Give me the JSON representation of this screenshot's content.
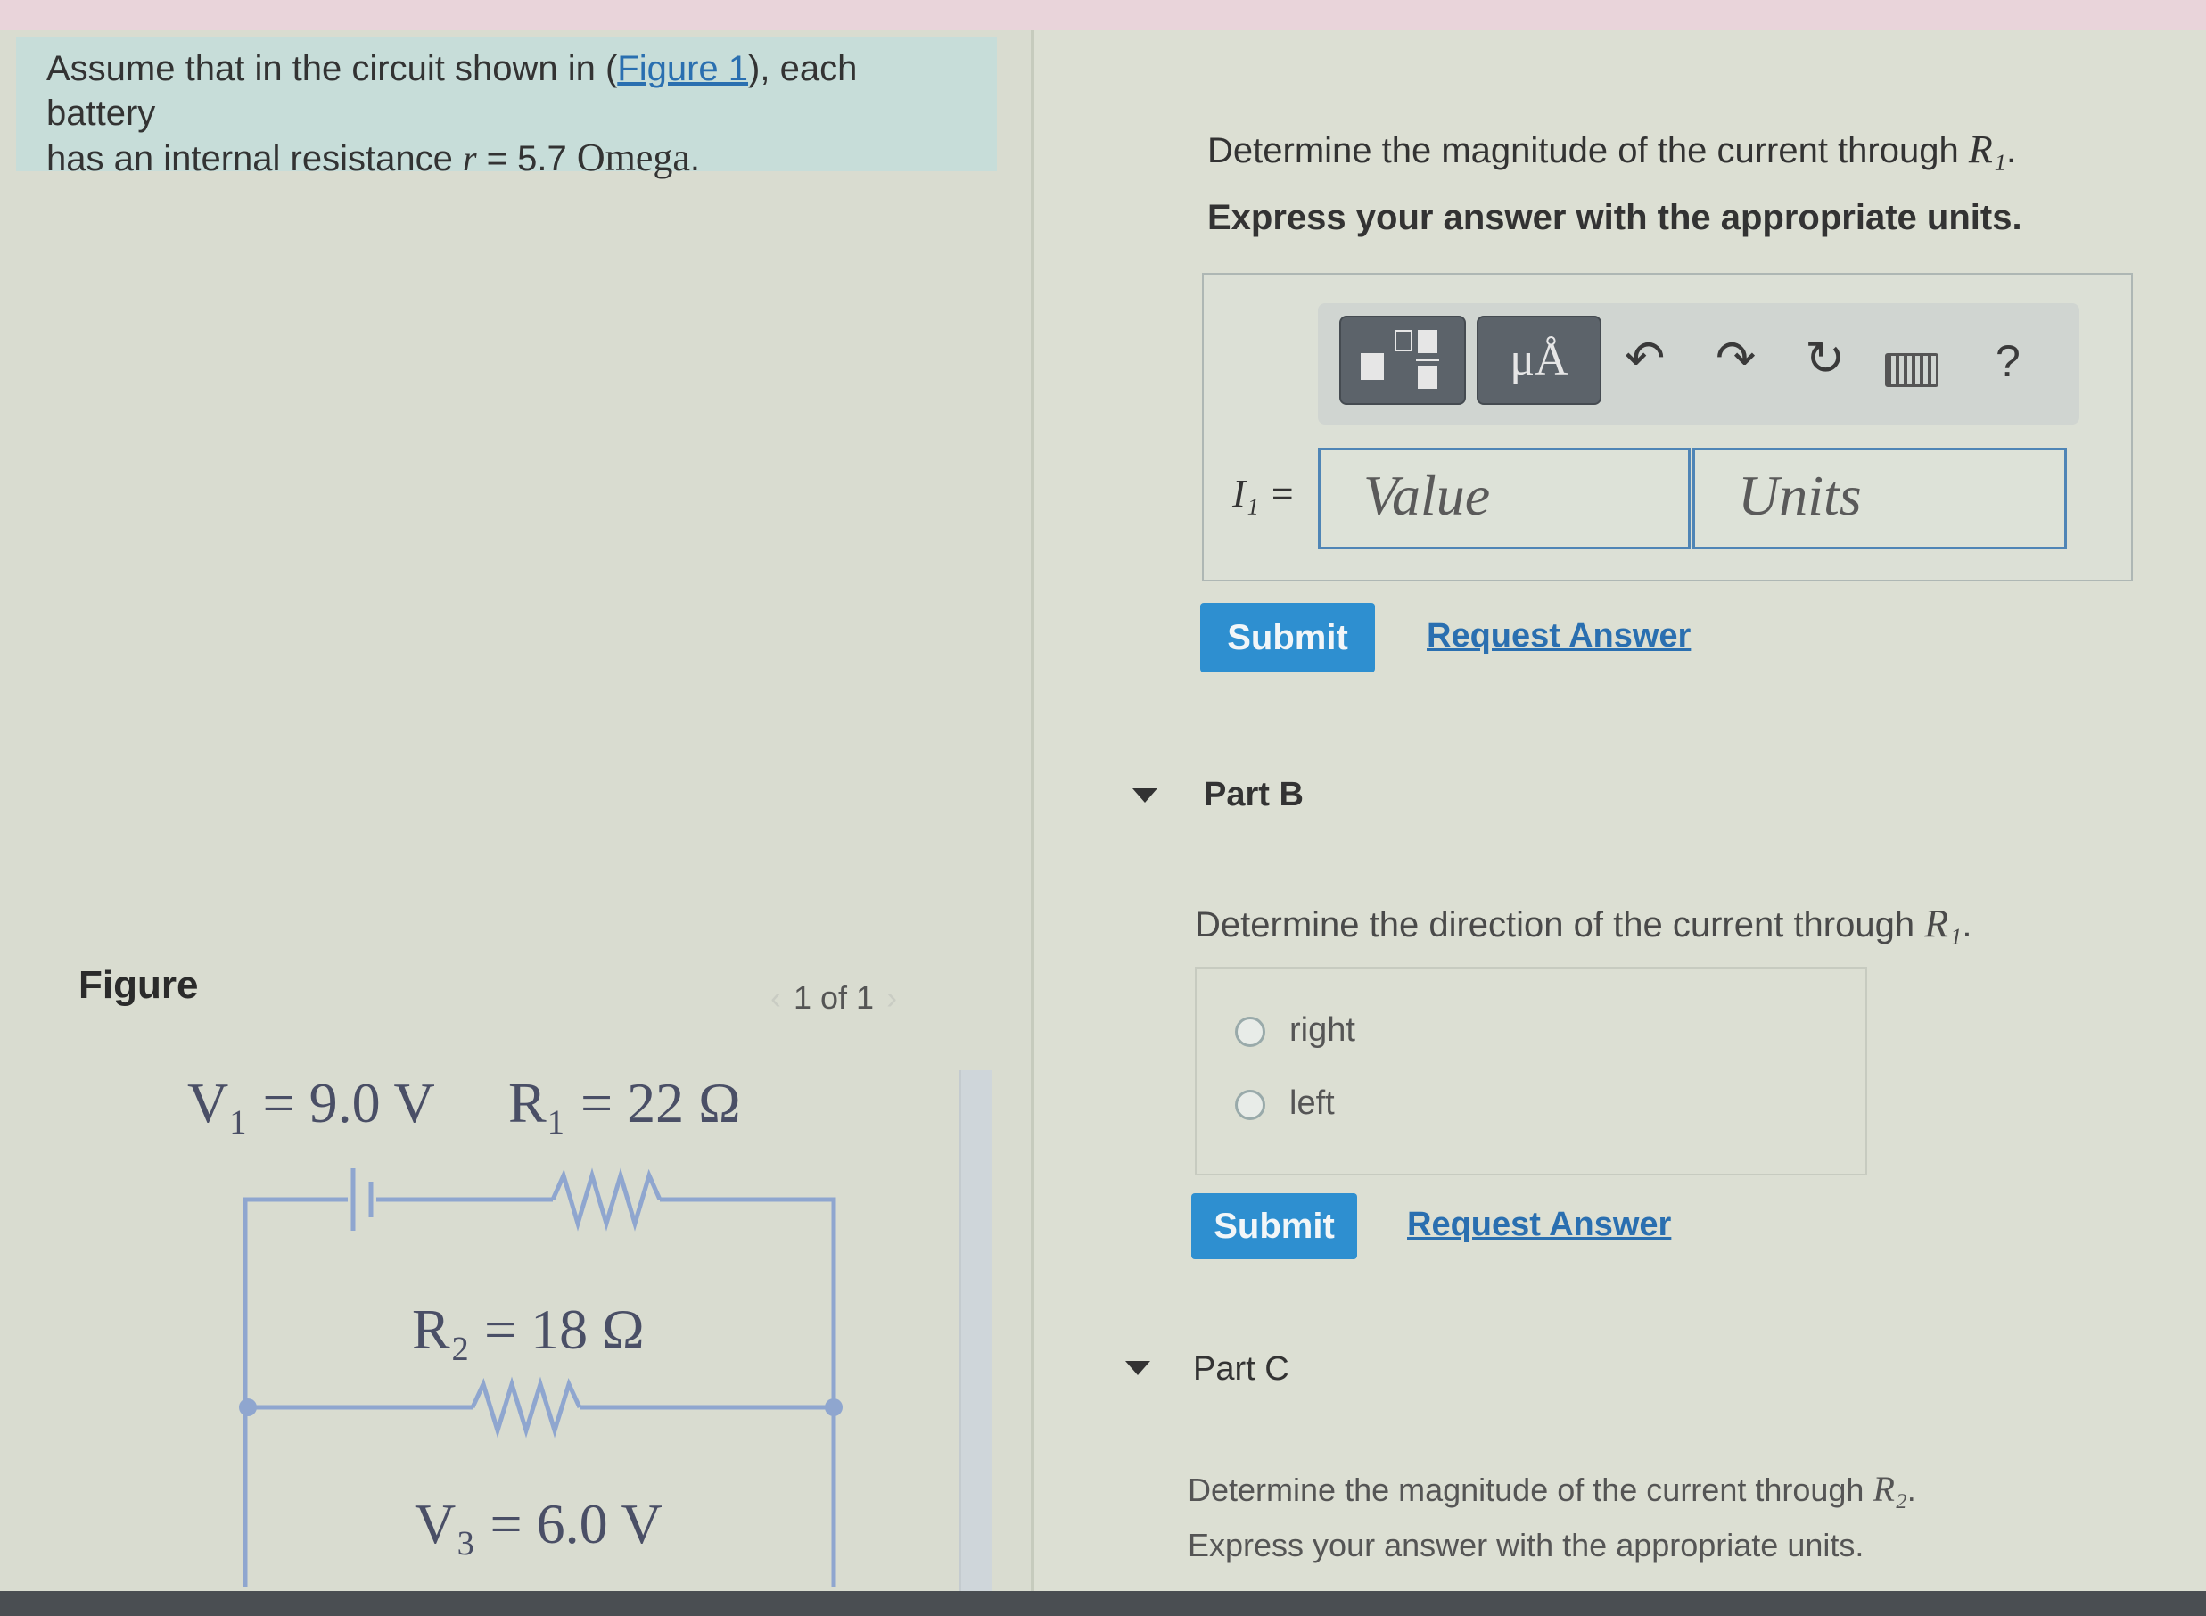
{
  "problem": {
    "intro_part1": "Assume that in the circuit shown in (",
    "figure_link": "Figure 1",
    "intro_part2": "), each battery",
    "intro_line2_a": "has an internal resistance ",
    "r_symbol": "r",
    "r_value": " = 5.7 ",
    "omega_word": "Omega",
    "period": "."
  },
  "figure": {
    "label": "Figure",
    "pager": "1 of 1",
    "prev_icon": "chevron-left-icon",
    "next_icon": "chevron-right-icon",
    "v1_label": "V₁ = 9.0 V",
    "r1_label": "R₁ = 22 Ω",
    "r2_label": "R₂ = 18 Ω",
    "v3_label": "V₃ = 6.0 V"
  },
  "part_a": {
    "question_text": "Determine the magnitude of the current through ",
    "question_var": "R₁",
    "question_end": ".",
    "instruction": "Express your answer with the appropriate units.",
    "answer_label": "I₁ =",
    "value_placeholder": "Value",
    "units_placeholder": "Units",
    "toolbar": {
      "template_icon": "fraction-template-icon",
      "units_button": "μÅ",
      "undo_icon": "undo-icon",
      "redo_icon": "redo-icon",
      "reset_icon": "reset-icon",
      "keyboard_icon": "keyboard-icon",
      "help": "?"
    },
    "submit": "Submit",
    "request_answer": "Request Answer"
  },
  "part_b": {
    "label": "Part B",
    "question_text": "Determine the direction of the current through ",
    "question_var": "R₁",
    "question_end": ".",
    "options": [
      "right",
      "left"
    ],
    "submit": "Submit",
    "request_answer": "Request Answer"
  },
  "part_c": {
    "label": "Part C",
    "question_text": "Determine the magnitude of the current through ",
    "question_var": "R₂",
    "question_end": ".",
    "instruction": "Express your answer with the appropriate units."
  },
  "colors": {
    "accent": "#2e8fd0",
    "link": "#2a6fb0",
    "intro_bg": "#c7ddd9"
  }
}
